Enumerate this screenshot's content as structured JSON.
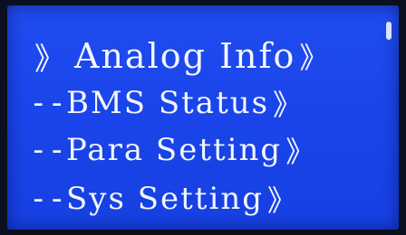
{
  "menu": {
    "items": [
      {
        "prefix": "》",
        "label": "Analog Info",
        "suffix": "》"
      },
      {
        "prefix": "--",
        "label": "BMS Status",
        "suffix": "》"
      },
      {
        "prefix": "--",
        "label": "Para Setting",
        "suffix": "》"
      },
      {
        "prefix": "--",
        "label": "Sys Setting",
        "suffix": "》"
      }
    ]
  },
  "colors": {
    "lcd_background": "#1a45ea",
    "text": "#f4f6ff"
  }
}
